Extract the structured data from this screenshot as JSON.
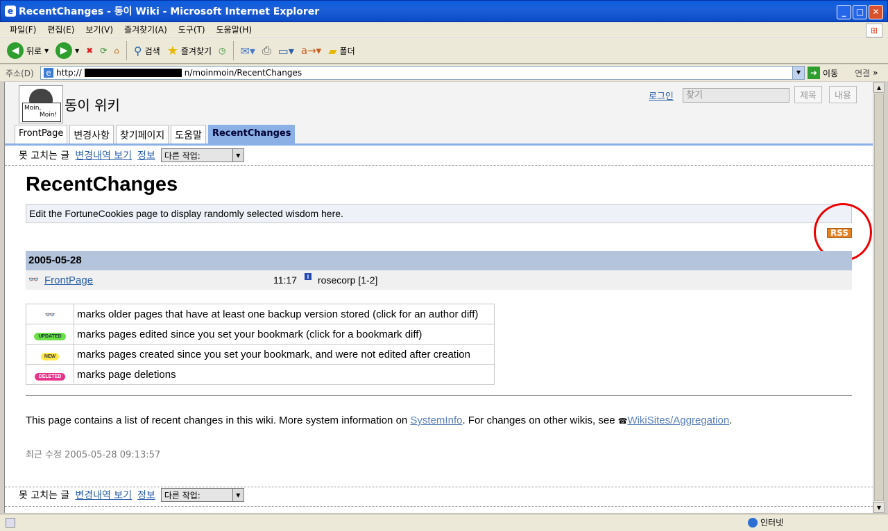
{
  "window": {
    "title": "RecentChanges - 동이 Wiki - Microsoft Internet Explorer"
  },
  "menu": [
    "파일(F)",
    "편집(E)",
    "보기(V)",
    "즐겨찾기(A)",
    "도구(T)",
    "도움말(H)"
  ],
  "toolbar": {
    "back": "뒤로",
    "search": "검색",
    "favorites": "즐겨찾기",
    "folders": "폴더"
  },
  "address": {
    "label": "주소(D)",
    "url_prefix": "http://",
    "url_suffix": "n/moinmoin/RecentChanges",
    "go": "이동",
    "links": "연결"
  },
  "wiki": {
    "logo_text_1": "Moin,",
    "logo_text_2": "Moin!",
    "site_name": "동이 위키",
    "login": "로그인",
    "search_placeholder": "찾기",
    "title_button": "제목",
    "text_button": "내용",
    "tabs": [
      "FrontPage",
      "변경사항",
      "찾기페이지",
      "도움말",
      "RecentChanges"
    ],
    "editbar": {
      "immutable": "못 고치는 글",
      "history": "변경내역 보기",
      "info": "정보",
      "more_actions": "다른 작업:"
    }
  },
  "page": {
    "title": "RecentChanges",
    "fortune": "Edit the FortuneCookies page to display randomly selected wisdom here.",
    "rss": "RSS",
    "date": "2005-05-28",
    "change": {
      "page": "FrontPage",
      "time": "11:17",
      "info_icon": "i",
      "editor": "rosecorp [1-2]"
    },
    "legend": [
      {
        "badge": "diff",
        "text": "marks older pages that have at least one backup version stored (click for an author diff)"
      },
      {
        "badge": "UPDATED",
        "text": "marks pages edited since you set your bookmark (click for a bookmark diff)"
      },
      {
        "badge": "NEW",
        "text": "marks pages created since you set your bookmark, and were not edited after creation"
      },
      {
        "badge": "DELETED",
        "text": "marks page deletions"
      }
    ],
    "sysinfo": {
      "part1": "This page contains a list of recent changes in this wiki. More system information on ",
      "link1": "SystemInfo",
      "part2": ". For changes on other wikis, see ",
      "link2": "WikiSites/Aggregation",
      "part3": "."
    },
    "last_modified": "최근 수정 2005-05-28 09:13:57"
  },
  "status": {
    "zone": "인터넷"
  },
  "colors": {
    "tab_active": "#8ab0e6",
    "date_row": "#b4c4dc",
    "link": "#2a5fa8",
    "rss": "#e67e22"
  }
}
